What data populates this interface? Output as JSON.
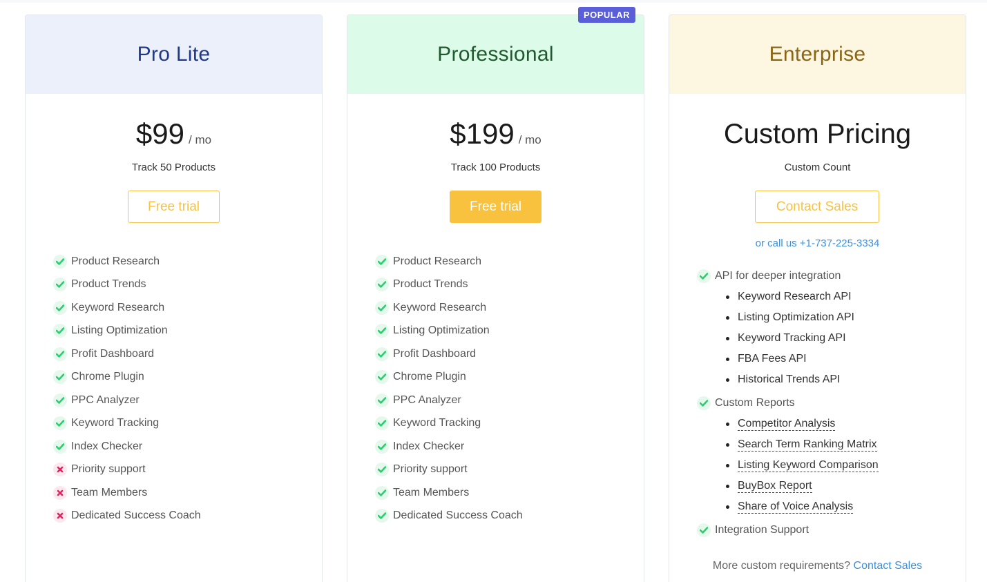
{
  "plans": [
    {
      "name": "Pro Lite",
      "price": "$99",
      "per": "/ mo",
      "subtitle": "Track 50 Products",
      "button": "Free trial",
      "features": [
        {
          "label": "Product Research",
          "included": true
        },
        {
          "label": "Product Trends",
          "included": true
        },
        {
          "label": "Keyword Research",
          "included": true
        },
        {
          "label": "Listing Optimization",
          "included": true
        },
        {
          "label": "Profit Dashboard",
          "included": true
        },
        {
          "label": "Chrome Plugin",
          "included": true
        },
        {
          "label": "PPC Analyzer",
          "included": true
        },
        {
          "label": "Keyword Tracking",
          "included": true
        },
        {
          "label": "Index Checker",
          "included": true
        },
        {
          "label": "Priority support",
          "included": false
        },
        {
          "label": "Team Members",
          "included": false
        },
        {
          "label": "Dedicated Success Coach",
          "included": false
        }
      ]
    },
    {
      "name": "Professional",
      "badge": "POPULAR",
      "price": "$199",
      "per": "/ mo",
      "subtitle": "Track 100 Products",
      "button": "Free trial",
      "features": [
        {
          "label": "Product Research",
          "included": true
        },
        {
          "label": "Product Trends",
          "included": true
        },
        {
          "label": "Keyword Research",
          "included": true
        },
        {
          "label": "Listing Optimization",
          "included": true
        },
        {
          "label": "Profit Dashboard",
          "included": true
        },
        {
          "label": "Chrome Plugin",
          "included": true
        },
        {
          "label": "PPC Analyzer",
          "included": true
        },
        {
          "label": "Keyword Tracking",
          "included": true
        },
        {
          "label": "Index Checker",
          "included": true
        },
        {
          "label": "Priority support",
          "included": true
        },
        {
          "label": "Team Members",
          "included": true
        },
        {
          "label": "Dedicated Success Coach",
          "included": true
        }
      ]
    },
    {
      "name": "Enterprise",
      "price_text": "Custom Pricing",
      "subtitle": "Custom Count",
      "button": "Contact Sales",
      "call_prefix": "or call us ",
      "call_number": "+1-737-225-3334",
      "groups": [
        {
          "label": "API for deeper integration",
          "items": [
            "Keyword Research API",
            "Listing Optimization API",
            "Keyword Tracking API",
            "FBA Fees API",
            "Historical Trends API"
          ]
        },
        {
          "label": "Custom Reports",
          "items": [
            "Competitor Analysis",
            "Search Term Ranking Matrix",
            "Listing Keyword Comparison",
            "BuyBox Report",
            "Share of Voice Analysis"
          ]
        },
        {
          "label": "Integration Support",
          "items": []
        }
      ],
      "more_text": "More custom requirements? ",
      "more_link": "Contact Sales"
    }
  ],
  "colors": {
    "check": "#2ecc71",
    "cross": "#e0245e",
    "accent": "#f8c23f",
    "link": "#3b8fe0",
    "badge": "#5a5fd8"
  }
}
